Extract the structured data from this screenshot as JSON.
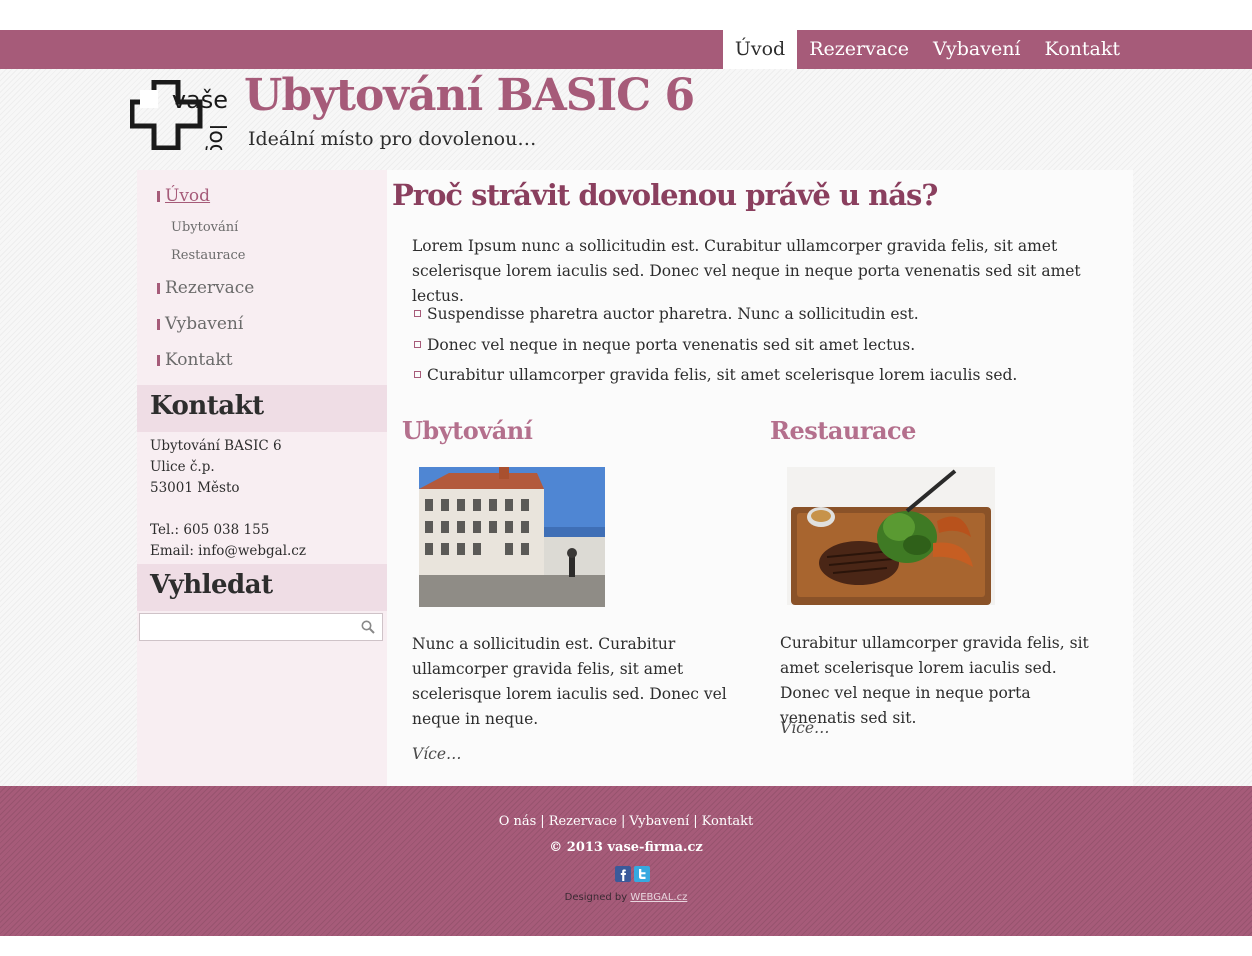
{
  "topnav": [
    "Úvod",
    "Rezervace",
    "Vybavení",
    "Kontakt"
  ],
  "header": {
    "logo_text_top": "vaše",
    "logo_text_bottom": "logo",
    "title": "Ubytování BASIC 6",
    "slogan": "Ideální místo pro dovolenou…"
  },
  "sidebar": {
    "nav": [
      {
        "label": "Úvod"
      },
      {
        "label": "Ubytování"
      },
      {
        "label": "Restaurace"
      },
      {
        "label": "Rezervace"
      },
      {
        "label": "Vybavení"
      },
      {
        "label": "Kontakt"
      }
    ],
    "contact": {
      "heading": "Kontakt",
      "name": "Ubytování BASIC 6",
      "street": "Ulice č.p.",
      "city": "53001 Město",
      "phone": "Tel.: 605 038 155",
      "email": "Email: info@webgal.cz"
    },
    "search": {
      "heading": "Vyhledat",
      "value": ""
    }
  },
  "main": {
    "heading": "Proč strávit dovolenou právě u nás?",
    "intro": "Lorem Ipsum nunc a sollicitudin est. Curabitur ullamcorper gravida felis, sit amet scelerisque lorem iaculis sed. Donec vel neque in neque porta venenatis sed sit amet lectus.",
    "bullets": [
      "Suspendisse pharetra auctor pharetra. Nunc a sollicitudin est.",
      "Donec vel neque in neque porta venenatis sed sit amet lectus.",
      "Curabitur ullamcorper gravida felis, sit amet scelerisque lorem iaculis sed."
    ],
    "columns": [
      {
        "title": "Ubytování",
        "text": "Nunc a sollicitudin est. Curabitur ullamcorper gravida felis, sit amet scelerisque lorem iaculis sed. Donec vel neque in neque.",
        "more": "Více…"
      },
      {
        "title": "Restaurace",
        "text": "Curabitur ullamcorper gravida felis, sit amet scelerisque lorem iaculis sed. Donec vel neque in neque porta venenatis sed sit.",
        "more": "Více…"
      }
    ]
  },
  "footer": {
    "links": [
      "O nás",
      "Rezervace",
      "Vybavení",
      "Kontakt"
    ],
    "separator": "|",
    "copyright": "© 2013 vase-firma.cz",
    "designed_by_prefix": "Designed by",
    "designed_by_link": "WEBGAL.cz"
  },
  "colors": {
    "brand": "#a65b79",
    "sidebar_bg": "#f8eef2",
    "widget_head_bg": "#efdde5",
    "heading_dark": "#8a3f5e",
    "heading_light": "#b4708d"
  }
}
